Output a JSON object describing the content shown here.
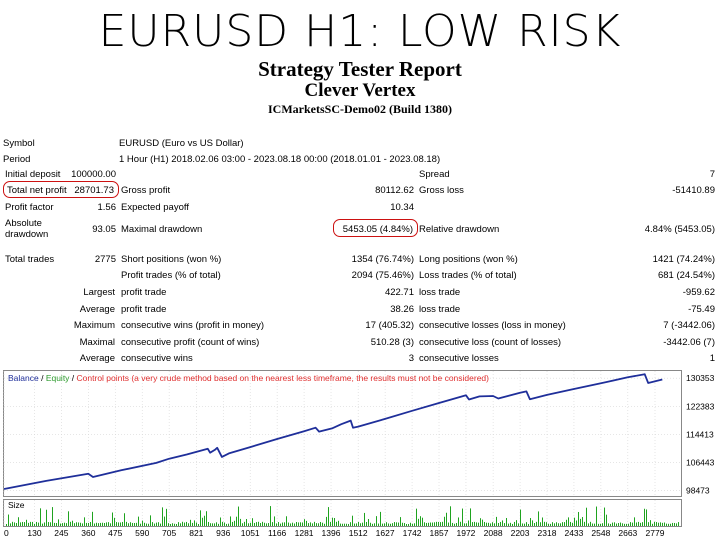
{
  "headline": "EURUSD H1: LOW RISK",
  "report": {
    "title": "Strategy Tester Report",
    "expert": "Clever Vertex",
    "server": "ICMarketsSC-Demo02 (Build 1380)"
  },
  "info": {
    "symbol_label": "Symbol",
    "symbol_value": "EURUSD (Euro vs US Dollar)",
    "period_label": "Period",
    "period_value": "1 Hour (H1) 2018.02.06 03:00 - 2023.08.18 00:00 (2018.01.01 - 2023.08.18)"
  },
  "stats": {
    "initial_deposit_label": "Initial deposit",
    "initial_deposit": "100000.00",
    "spread_label": "Spread",
    "spread": "7",
    "total_net_profit_label": "Total net profit",
    "total_net_profit": "28701.73",
    "gross_profit_label": "Gross profit",
    "gross_profit": "80112.62",
    "gross_loss_label": "Gross loss",
    "gross_loss": "-51410.89",
    "profit_factor_label": "Profit factor",
    "profit_factor": "1.56",
    "expected_payoff_label": "Expected payoff",
    "expected_payoff": "10.34",
    "absolute_drawdown_label_1": "Absolute",
    "absolute_drawdown_label_2": "drawdown",
    "absolute_drawdown": "93.05",
    "maximal_drawdown_label": "Maximal drawdown",
    "maximal_drawdown": "5453.05 (4.84%)",
    "relative_drawdown_label": "Relative drawdown",
    "relative_drawdown": "4.84% (5453.05)",
    "total_trades_label": "Total trades",
    "total_trades": "2775",
    "short_positions_label": "Short positions (won %)",
    "short_positions": "1354 (76.74%)",
    "long_positions_label": "Long positions (won %)",
    "long_positions": "1421 (74.24%)",
    "profit_trades_label": "Profit trades (% of total)",
    "profit_trades": "2094 (75.46%)",
    "loss_trades_label": "Loss trades (% of total)",
    "loss_trades": "681 (24.54%)",
    "largest_label": "Largest",
    "largest_profit_label": "profit trade",
    "largest_profit": "422.71",
    "largest_loss_label": "loss trade",
    "largest_loss": "-959.62",
    "average_label": "Average",
    "average_profit_label": "profit trade",
    "average_profit": "38.26",
    "average_loss_label": "loss trade",
    "average_loss": "-75.49",
    "maximum_label": "Maximum",
    "max_consec_wins_label": "consecutive wins (profit in money)",
    "max_consec_wins": "17 (405.32)",
    "max_consec_losses_label": "consecutive losses (loss in money)",
    "max_consec_losses": "7 (-3442.06)",
    "maximal_label": "Maximal",
    "maximal_consec_profit_label": "consecutive profit (count of wins)",
    "maximal_consec_profit": "510.28 (3)",
    "maximal_consec_loss_label": "consecutive loss (count of losses)",
    "maximal_consec_loss": "-3442.06 (7)",
    "average2_label": "Average",
    "avg_consec_wins_label": "consecutive wins",
    "avg_consec_wins": "3",
    "avg_consec_losses_label": "consecutive losses",
    "avg_consec_losses": "1"
  },
  "colors": {
    "balance": "#1f2f9a",
    "equity": "#2e9c2e",
    "control": "#e03030",
    "highlight": "#cc1111",
    "size_bars": "#1fa31f"
  },
  "chart_data": {
    "type": "line",
    "legend": {
      "balance": "Balance",
      "sep1": " / ",
      "equity": "Equity",
      "sep2": " / ",
      "control": "Control points (a very crude method based on the nearest less timeframe, the results must not be considered)"
    },
    "size_label": "Size",
    "y_ticks": [
      98473,
      106443,
      114413,
      122383,
      130353
    ],
    "x_ticks": [
      0,
      130,
      245,
      360,
      475,
      590,
      705,
      821,
      936,
      1051,
      1166,
      1281,
      1396,
      1512,
      1627,
      1742,
      1857,
      1972,
      2088,
      2203,
      2318,
      2433,
      2548,
      2663,
      2779
    ],
    "xlim": [
      0,
      2890
    ],
    "ylim": [
      96900,
      132400
    ],
    "series": [
      {
        "name": "Balance",
        "points": [
          [
            0,
            98900
          ],
          [
            180,
            101200
          ],
          [
            360,
            103200
          ],
          [
            380,
            102300
          ],
          [
            500,
            104200
          ],
          [
            650,
            106300
          ],
          [
            705,
            107500
          ],
          [
            780,
            108700
          ],
          [
            870,
            110300
          ],
          [
            880,
            109200
          ],
          [
            900,
            110000
          ],
          [
            910,
            110600
          ],
          [
            930,
            108000
          ],
          [
            960,
            109000
          ],
          [
            1051,
            110800
          ],
          [
            1166,
            113100
          ],
          [
            1281,
            115300
          ],
          [
            1330,
            116300
          ],
          [
            1345,
            115200
          ],
          [
            1400,
            116100
          ],
          [
            1440,
            117300
          ],
          [
            1480,
            118300
          ],
          [
            1490,
            116300
          ],
          [
            1512,
            116600
          ],
          [
            1627,
            118800
          ],
          [
            1742,
            121100
          ],
          [
            1857,
            123300
          ],
          [
            1972,
            125500
          ],
          [
            1985,
            124300
          ],
          [
            2030,
            125200
          ],
          [
            2088,
            125300
          ],
          [
            2110,
            124600
          ],
          [
            2203,
            126200
          ],
          [
            2230,
            126600
          ],
          [
            2245,
            124400
          ],
          [
            2318,
            125600
          ],
          [
            2433,
            127300
          ],
          [
            2548,
            128900
          ],
          [
            2663,
            130600
          ],
          [
            2735,
            131500
          ],
          [
            2750,
            129000
          ],
          [
            2810,
            130000
          ]
        ]
      }
    ]
  }
}
